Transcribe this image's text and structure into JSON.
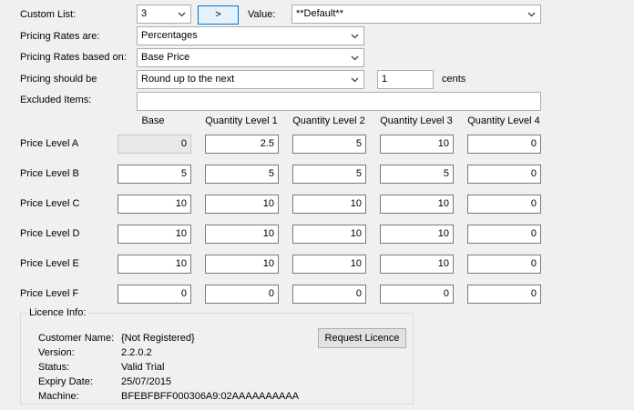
{
  "custom_list": {
    "label": "Custom List:",
    "value": "3",
    "go_button": ">",
    "value_label": "Value:",
    "value_selected": "**Default**"
  },
  "pricing_rates": {
    "label": "Pricing Rates are:",
    "value": "Percentages"
  },
  "pricing_based": {
    "label": "Pricing Rates based on:",
    "value": "Base Price"
  },
  "pricing_should": {
    "label": "Pricing should be",
    "value": "Round up to the next",
    "amount": "1",
    "unit": "cents"
  },
  "excluded": {
    "label": "Excluded Items:",
    "value": ""
  },
  "columns": [
    "Base",
    "Quantity Level 1",
    "Quantity Level 2",
    "Quantity Level 3",
    "Quantity Level 4"
  ],
  "price_levels": [
    {
      "label": "Price Level A",
      "values": [
        "0",
        "2.5",
        "5",
        "10",
        "0"
      ]
    },
    {
      "label": "Price Level B",
      "values": [
        "5",
        "5",
        "5",
        "5",
        "0"
      ]
    },
    {
      "label": "Price Level C",
      "values": [
        "10",
        "10",
        "10",
        "10",
        "0"
      ]
    },
    {
      "label": "Price Level D",
      "values": [
        "10",
        "10",
        "10",
        "10",
        "0"
      ]
    },
    {
      "label": "Price Level E",
      "values": [
        "10",
        "10",
        "10",
        "10",
        "0"
      ]
    },
    {
      "label": "Price Level F",
      "values": [
        "0",
        "0",
        "0",
        "0",
        "0"
      ]
    }
  ],
  "licence": {
    "title": "Licence Info:",
    "request_button": "Request Licence",
    "customer_label": "Customer Name:",
    "customer_value": "{Not Registered}",
    "version_label": "Version:",
    "version_value": "2.2.0.2",
    "status_label": "Status:",
    "status_value": "Valid Trial",
    "expiry_label": "Expiry Date:",
    "expiry_value": "25/07/2015",
    "machine_label": "Machine:",
    "machine_value": "BFEBFBFF000306A9:02AAAAAAAAAA"
  },
  "colors": {
    "window_bg": "#f0f0f0",
    "focus_border": "#0078d7",
    "disabled_field": "#e8e8e8"
  },
  "icons": {
    "dropdown": "chevron-down-icon"
  }
}
